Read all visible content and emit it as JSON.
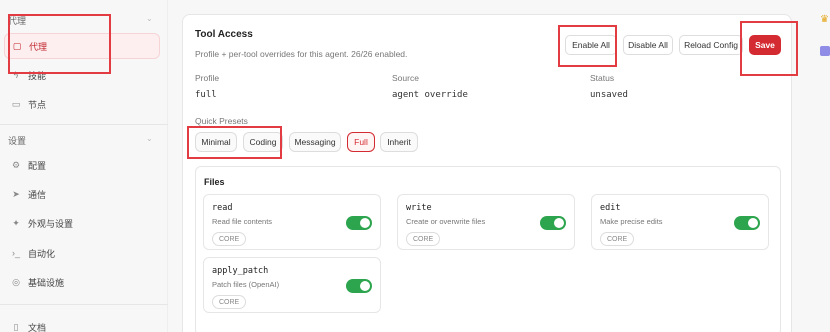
{
  "sidebar": {
    "section_agent": "代理",
    "items_top": [
      {
        "label": "代理",
        "icon": "folder-icon"
      },
      {
        "label": "技能",
        "icon": "bolt-icon"
      },
      {
        "label": "节点",
        "icon": "monitor-icon"
      }
    ],
    "section_settings": "设置",
    "items_settings": [
      {
        "label": "配置",
        "icon": "gear-icon"
      },
      {
        "label": "通信",
        "icon": "send-icon"
      },
      {
        "label": "外观与设置",
        "icon": "sparkle-icon"
      },
      {
        "label": "自动化",
        "icon": "terminal-icon"
      },
      {
        "label": "基础设施",
        "icon": "globe-icon"
      }
    ],
    "docs": "文档"
  },
  "tool_access": {
    "title": "Tool Access",
    "subtitle": "Profile + per-tool overrides for this agent. 26/26 enabled.",
    "buttons": {
      "enable_all": "Enable All",
      "disable_all": "Disable All",
      "reload_config": "Reload Config",
      "save": "Save"
    },
    "profile_label": "Profile",
    "profile_value": "full",
    "source_label": "Source",
    "source_value": "agent override",
    "status_label": "Status",
    "status_value": "unsaved",
    "quick_presets_label": "Quick Presets",
    "presets": [
      "Minimal",
      "Coding",
      "Messaging",
      "Full",
      "Inherit"
    ],
    "selected_preset": "Full"
  },
  "files": {
    "title": "Files",
    "tools": [
      {
        "name": "read",
        "desc": "Read file contents",
        "tag": "CORE",
        "enabled": true
      },
      {
        "name": "write",
        "desc": "Create or overwrite files",
        "tag": "CORE",
        "enabled": true
      },
      {
        "name": "edit",
        "desc": "Make precise edits",
        "tag": "CORE",
        "enabled": true
      },
      {
        "name": "apply_patch",
        "desc": "Patch files (OpenAI)",
        "tag": "CORE",
        "enabled": true
      }
    ]
  },
  "colors": {
    "accent": "#d42a31",
    "toggle_on": "#2da44e"
  }
}
